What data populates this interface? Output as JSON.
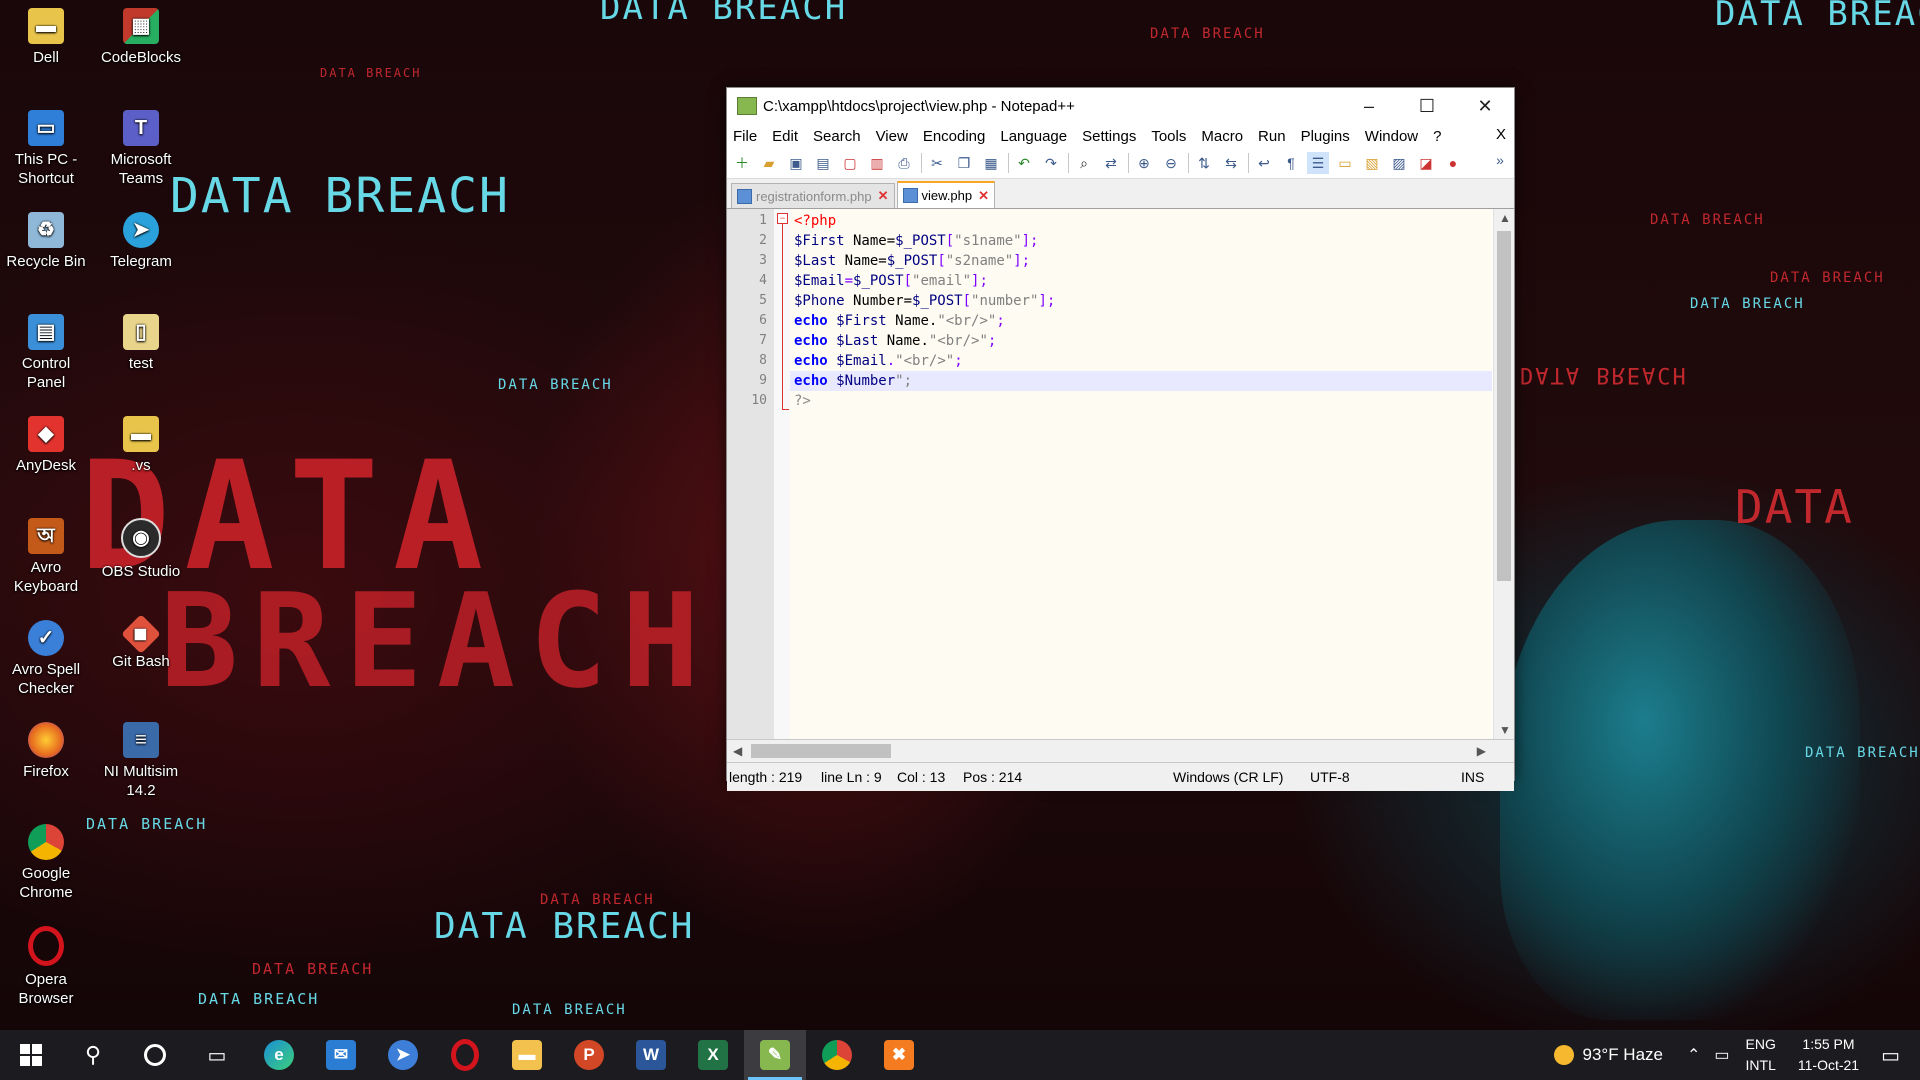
{
  "wallpaper": {
    "banner_texts": [
      "DATA BREACH",
      "DATA BREACH",
      "DATA BREACH",
      "DATA BREACH",
      "DATA BREACH",
      "DATA BREACH",
      "DATA BREACH",
      "DATA BREACH",
      "DATA BREACH",
      "DATA BREACH",
      "DATA BREACH",
      "DATA BREACH",
      "DATA BREACH",
      "DATA BREACH",
      "DATA BREACH",
      "DATA BREACH",
      "DATA BREACH",
      "DATA"
    ],
    "big_text_1": "DATA",
    "big_text_2": "BREACH"
  },
  "desktop_icons": [
    {
      "label": "Dell",
      "icon": "folder-icon",
      "color": "#e8c44a"
    },
    {
      "label": "CodeBlocks",
      "icon": "codeblocks-icon",
      "color": "#c0392b"
    },
    {
      "label": "This PC - Shortcut",
      "icon": "computer-icon",
      "color": "#2f7fd8"
    },
    {
      "label": "Microsoft Teams",
      "icon": "teams-icon",
      "color": "#5b5fc7"
    },
    {
      "label": "Recycle Bin",
      "icon": "recycle-bin-icon",
      "color": "#8fb8d8"
    },
    {
      "label": "Telegram",
      "icon": "telegram-icon",
      "color": "#2aa1da"
    },
    {
      "label": "Control Panel",
      "icon": "control-panel-icon",
      "color": "#3a8fd8"
    },
    {
      "label": "test",
      "icon": "file-icon",
      "color": "#e8d48a"
    },
    {
      "label": "AnyDesk",
      "icon": "anydesk-icon",
      "color": "#e2332e"
    },
    {
      "label": ".vs",
      "icon": "folder-icon",
      "color": "#e8c44a"
    },
    {
      "label": "Avro Keyboard",
      "icon": "avro-keyboard-icon",
      "color": "#c45a1a"
    },
    {
      "label": "OBS Studio",
      "icon": "obs-icon",
      "color": "#2b2b2b"
    },
    {
      "label": "Avro Spell Checker",
      "icon": "avro-spell-icon",
      "color": "#3a7fd8"
    },
    {
      "label": "Git Bash",
      "icon": "git-bash-icon",
      "color": "#e0513c"
    },
    {
      "label": "Firefox",
      "icon": "firefox-icon",
      "color": "#e66a1f"
    },
    {
      "label": "NI Multisim 14.2",
      "icon": "multisim-icon",
      "color": "#3b6aa8"
    },
    {
      "label": "Google Chrome",
      "icon": "chrome-icon",
      "color": "#2e9e4f"
    },
    {
      "label": "Opera Browser",
      "icon": "opera-icon",
      "color": "#d4141c"
    }
  ],
  "window": {
    "title": "C:\\xampp\\htdocs\\project\\view.php - Notepad++",
    "minimize": "–",
    "maximize": "☐",
    "close": "✕",
    "menu": [
      "File",
      "Edit",
      "Search",
      "View",
      "Encoding",
      "Language",
      "Settings",
      "Tools",
      "Macro",
      "Run",
      "Plugins",
      "Window",
      "?"
    ],
    "menu_close": "X",
    "tabs": [
      {
        "label": "registrationform.php",
        "active": false
      },
      {
        "label": "view.php",
        "active": true
      }
    ],
    "tab_close": "✕",
    "code_lines": [
      {
        "n": "1",
        "tokens": [
          {
            "t": "<?php",
            "c": "php-tag"
          }
        ]
      },
      {
        "n": "2",
        "tokens": [
          {
            "t": "$First",
            "c": "var"
          },
          {
            "t": " Name=",
            "c": "plain"
          },
          {
            "t": "$_POST",
            "c": "var"
          },
          {
            "t": "[",
            "c": "op"
          },
          {
            "t": "\"s1name\"",
            "c": "str"
          },
          {
            "t": "];",
            "c": "op"
          }
        ]
      },
      {
        "n": "3",
        "tokens": [
          {
            "t": "$Last",
            "c": "var"
          },
          {
            "t": " Name=",
            "c": "plain"
          },
          {
            "t": "$_POST",
            "c": "var"
          },
          {
            "t": "[",
            "c": "op"
          },
          {
            "t": "\"s2name\"",
            "c": "str"
          },
          {
            "t": "];",
            "c": "op"
          }
        ]
      },
      {
        "n": "4",
        "tokens": [
          {
            "t": "$Email",
            "c": "var"
          },
          {
            "t": "=",
            "c": "op"
          },
          {
            "t": "$_POST",
            "c": "var"
          },
          {
            "t": "[",
            "c": "op"
          },
          {
            "t": "\"email\"",
            "c": "str"
          },
          {
            "t": "];",
            "c": "op"
          }
        ]
      },
      {
        "n": "5",
        "tokens": [
          {
            "t": "$Phone",
            "c": "var"
          },
          {
            "t": " Number=",
            "c": "plain"
          },
          {
            "t": "$_POST",
            "c": "var"
          },
          {
            "t": "[",
            "c": "op"
          },
          {
            "t": "\"number\"",
            "c": "str"
          },
          {
            "t": "];",
            "c": "op"
          }
        ]
      },
      {
        "n": "6",
        "tokens": [
          {
            "t": "echo",
            "c": "kw"
          },
          {
            "t": " ",
            "c": "plain"
          },
          {
            "t": "$First",
            "c": "var"
          },
          {
            "t": " Name.",
            "c": "plain"
          },
          {
            "t": "\"<br/>\"",
            "c": "str"
          },
          {
            "t": ";",
            "c": "op"
          }
        ]
      },
      {
        "n": "7",
        "tokens": [
          {
            "t": "echo",
            "c": "kw"
          },
          {
            "t": " ",
            "c": "plain"
          },
          {
            "t": "$Last",
            "c": "var"
          },
          {
            "t": " Name.",
            "c": "plain"
          },
          {
            "t": "\"<br/>\"",
            "c": "str"
          },
          {
            "t": ";",
            "c": "op"
          }
        ]
      },
      {
        "n": "8",
        "tokens": [
          {
            "t": "echo",
            "c": "kw"
          },
          {
            "t": " ",
            "c": "plain"
          },
          {
            "t": "$Email",
            "c": "var"
          },
          {
            "t": ".",
            "c": "op"
          },
          {
            "t": "\"<br/>\"",
            "c": "str"
          },
          {
            "t": ";",
            "c": "op"
          }
        ]
      },
      {
        "n": "9",
        "tokens": [
          {
            "t": "echo",
            "c": "kw"
          },
          {
            "t": " ",
            "c": "plain"
          },
          {
            "t": "$Number",
            "c": "var"
          },
          {
            "t": "\";",
            "c": "str"
          }
        ]
      },
      {
        "n": "10",
        "tokens": [
          {
            "t": "?>",
            "c": "php-tag2"
          }
        ]
      }
    ],
    "current_line": 9,
    "status": {
      "length": "length : 219",
      "line": "line Ln : 9",
      "col": "Col : 13",
      "pos": "Pos : 214",
      "eol": "Windows (CR LF)",
      "encoding": "UTF-8",
      "mode": "INS"
    }
  },
  "taskbar": {
    "apps": [
      {
        "name": "start-button",
        "icon": "windows-icon"
      },
      {
        "name": "search-button",
        "icon": "search-icon"
      },
      {
        "name": "cortana-button",
        "icon": "cortana-icon"
      },
      {
        "name": "task-view-button",
        "icon": "task-view-icon"
      },
      {
        "name": "edge",
        "icon": "edge-icon",
        "color": "#1a8fd6"
      },
      {
        "name": "mail",
        "icon": "mail-icon",
        "color": "#2b7cd3"
      },
      {
        "name": "app-blue",
        "icon": "app-icon",
        "color": "#3d7fd8"
      },
      {
        "name": "opera",
        "icon": "opera-icon",
        "color": "#d4141c"
      },
      {
        "name": "file-explorer",
        "icon": "folder-icon",
        "color": "#f2c14e"
      },
      {
        "name": "powerpoint",
        "icon": "powerpoint-icon",
        "color": "#d24726"
      },
      {
        "name": "word",
        "icon": "word-icon",
        "color": "#2b579a"
      },
      {
        "name": "excel",
        "icon": "excel-icon",
        "color": "#217346"
      },
      {
        "name": "notepadpp",
        "icon": "notepadpp-icon",
        "color": "#86b84f",
        "active": true
      },
      {
        "name": "chrome",
        "icon": "chrome-icon",
        "color": "#2e9e4f"
      },
      {
        "name": "xampp",
        "icon": "xampp-icon",
        "color": "#f57b20"
      }
    ],
    "weather": "93°F  Haze",
    "lang_1": "ENG",
    "lang_2": "INTL",
    "time": "1:55 PM",
    "date": "11-Oct-21"
  }
}
